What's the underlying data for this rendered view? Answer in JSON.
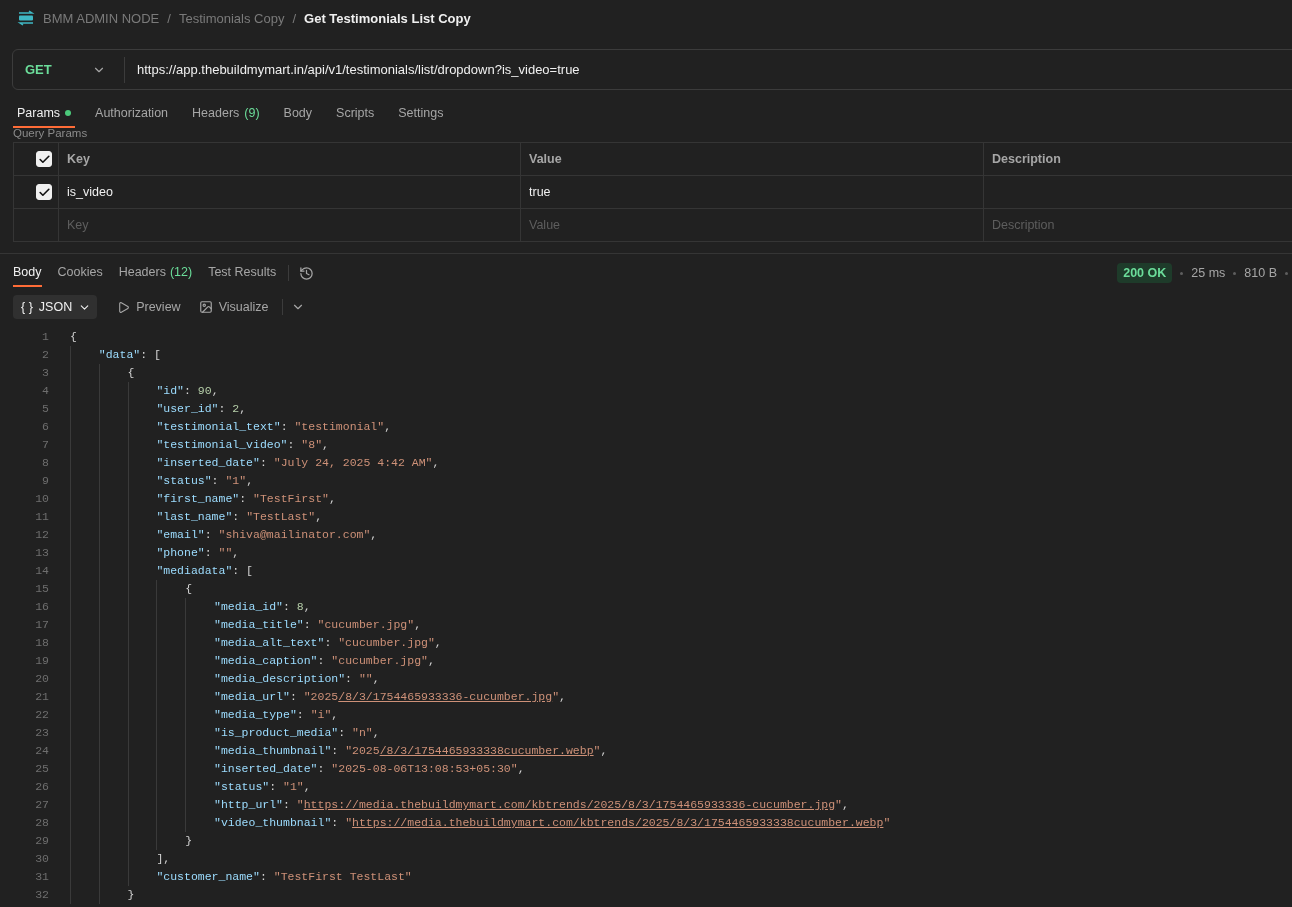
{
  "breadcrumb": [
    {
      "kind": "link",
      "label": "BMM ADMIN NODE"
    },
    {
      "kind": "separator",
      "label": "/"
    },
    {
      "kind": "link",
      "label": "Testimonials Copy"
    },
    {
      "kind": "separator",
      "label": "/"
    },
    {
      "kind": "current",
      "label": "Get Testimonials List Copy"
    }
  ],
  "request": {
    "method": "GET",
    "url": "https://app.thebuildmymart.in/api/v1/testimonials/list/dropdown?is_video=true"
  },
  "request_tabs": [
    {
      "label": "Params",
      "selected": true,
      "has_content": true
    },
    {
      "label": "Authorization",
      "selected": false,
      "has_content": false
    },
    {
      "label": "Headers",
      "count": "(9)",
      "selected": false,
      "has_content": false
    },
    {
      "label": "Body",
      "selected": false,
      "has_content": false
    },
    {
      "label": "Scripts",
      "selected": false,
      "has_content": false
    },
    {
      "label": "Settings",
      "selected": false,
      "has_content": false
    }
  ],
  "query_params": {
    "title": "Query Params",
    "all_checked": true,
    "columns": [
      "Key",
      "Value",
      "Description"
    ],
    "rows": [
      {
        "checked": true,
        "key": "is_video",
        "value": "true"
      }
    ],
    "new_row": {
      "key": "Key",
      "value": "Value",
      "description": "Description"
    }
  },
  "response_tabs": [
    {
      "label": "Body",
      "selected": true
    },
    {
      "label": "Cookies",
      "selected": false
    },
    {
      "label": "Headers",
      "count": "(12)",
      "selected": false
    },
    {
      "label": "Test Results",
      "selected": false
    }
  ],
  "status": {
    "code": "200 OK",
    "time": "25 ms",
    "size": "810 B"
  },
  "view": {
    "format_icon": "{ }",
    "format": "JSON",
    "options": [
      {
        "kind": "preview",
        "label": "Preview"
      },
      {
        "kind": "visualize",
        "label": "Visualize"
      }
    ]
  },
  "code": [
    {
      "n": "1",
      "t": [
        {
          "kind": "punct",
          "text": "{"
        }
      ],
      "children": [
        {
          "n": "2",
          "t": [
            {
              "kind": "key",
              "text": "\"data\""
            },
            {
              "kind": "punct",
              "text": ": ["
            }
          ],
          "children": [
            {
              "n": "3",
              "t": [
                {
                  "kind": "punct",
                  "text": "{"
                }
              ],
              "children": [
                {
                  "n": "4",
                  "t": [
                    {
                      "kind": "key",
                      "text": "\"id\""
                    },
                    {
                      "kind": "punct",
                      "text": ": "
                    },
                    {
                      "kind": "number",
                      "text": "90"
                    },
                    {
                      "kind": "punct",
                      "text": ","
                    }
                  ]
                },
                {
                  "n": "5",
                  "t": [
                    {
                      "kind": "key",
                      "text": "\"user_id\""
                    },
                    {
                      "kind": "punct",
                      "text": ": "
                    },
                    {
                      "kind": "number",
                      "text": "2"
                    },
                    {
                      "kind": "punct",
                      "text": ","
                    }
                  ]
                },
                {
                  "n": "6",
                  "t": [
                    {
                      "kind": "key",
                      "text": "\"testimonial_text\""
                    },
                    {
                      "kind": "punct",
                      "text": ": "
                    },
                    {
                      "kind": "string",
                      "text": "\"testimonial\""
                    },
                    {
                      "kind": "punct",
                      "text": ","
                    }
                  ]
                },
                {
                  "n": "7",
                  "t": [
                    {
                      "kind": "key",
                      "text": "\"testimonial_video\""
                    },
                    {
                      "kind": "punct",
                      "text": ": "
                    },
                    {
                      "kind": "string",
                      "text": "\"8\""
                    },
                    {
                      "kind": "punct",
                      "text": ","
                    }
                  ]
                },
                {
                  "n": "8",
                  "t": [
                    {
                      "kind": "key",
                      "text": "\"inserted_date\""
                    },
                    {
                      "kind": "punct",
                      "text": ": "
                    },
                    {
                      "kind": "string",
                      "text": "\"July 24, 2025 4:42 AM\""
                    },
                    {
                      "kind": "punct",
                      "text": ","
                    }
                  ]
                },
                {
                  "n": "9",
                  "t": [
                    {
                      "kind": "key",
                      "text": "\"status\""
                    },
                    {
                      "kind": "punct",
                      "text": ": "
                    },
                    {
                      "kind": "string",
                      "text": "\"1\""
                    },
                    {
                      "kind": "punct",
                      "text": ","
                    }
                  ]
                },
                {
                  "n": "10",
                  "t": [
                    {
                      "kind": "key",
                      "text": "\"first_name\""
                    },
                    {
                      "kind": "punct",
                      "text": ": "
                    },
                    {
                      "kind": "string",
                      "text": "\"TestFirst\""
                    },
                    {
                      "kind": "punct",
                      "text": ","
                    }
                  ]
                },
                {
                  "n": "11",
                  "t": [
                    {
                      "kind": "key",
                      "text": "\"last_name\""
                    },
                    {
                      "kind": "punct",
                      "text": ": "
                    },
                    {
                      "kind": "string",
                      "text": "\"TestLast\""
                    },
                    {
                      "kind": "punct",
                      "text": ","
                    }
                  ]
                },
                {
                  "n": "12",
                  "t": [
                    {
                      "kind": "key",
                      "text": "\"email\""
                    },
                    {
                      "kind": "punct",
                      "text": ": "
                    },
                    {
                      "kind": "string",
                      "text": "\"shiva@mailinator.com\""
                    },
                    {
                      "kind": "punct",
                      "text": ","
                    }
                  ]
                },
                {
                  "n": "13",
                  "t": [
                    {
                      "kind": "key",
                      "text": "\"phone\""
                    },
                    {
                      "kind": "punct",
                      "text": ": "
                    },
                    {
                      "kind": "string",
                      "text": "\"\""
                    },
                    {
                      "kind": "punct",
                      "text": ","
                    }
                  ]
                },
                {
                  "n": "14",
                  "t": [
                    {
                      "kind": "key",
                      "text": "\"mediadata\""
                    },
                    {
                      "kind": "punct",
                      "text": ": ["
                    }
                  ],
                  "children": [
                    {
                      "n": "15",
                      "t": [
                        {
                          "kind": "punct",
                          "text": "{"
                        }
                      ],
                      "children": [
                        {
                          "n": "16",
                          "t": [
                            {
                              "kind": "key",
                              "text": "\"media_id\""
                            },
                            {
                              "kind": "punct",
                              "text": ": "
                            },
                            {
                              "kind": "number",
                              "text": "8"
                            },
                            {
                              "kind": "punct",
                              "text": ","
                            }
                          ]
                        },
                        {
                          "n": "17",
                          "t": [
                            {
                              "kind": "key",
                              "text": "\"media_title\""
                            },
                            {
                              "kind": "punct",
                              "text": ": "
                            },
                            {
                              "kind": "string",
                              "text": "\"cucumber.jpg\""
                            },
                            {
                              "kind": "punct",
                              "text": ","
                            }
                          ]
                        },
                        {
                          "n": "18",
                          "t": [
                            {
                              "kind": "key",
                              "text": "\"media_alt_text\""
                            },
                            {
                              "kind": "punct",
                              "text": ": "
                            },
                            {
                              "kind": "string",
                              "text": "\"cucumber.jpg\""
                            },
                            {
                              "kind": "punct",
                              "text": ","
                            }
                          ]
                        },
                        {
                          "n": "19",
                          "t": [
                            {
                              "kind": "key",
                              "text": "\"media_caption\""
                            },
                            {
                              "kind": "punct",
                              "text": ": "
                            },
                            {
                              "kind": "string",
                              "text": "\"cucumber.jpg\""
                            },
                            {
                              "kind": "punct",
                              "text": ","
                            }
                          ]
                        },
                        {
                          "n": "20",
                          "t": [
                            {
                              "kind": "key",
                              "text": "\"media_description\""
                            },
                            {
                              "kind": "punct",
                              "text": ": "
                            },
                            {
                              "kind": "string",
                              "text": "\"\""
                            },
                            {
                              "kind": "punct",
                              "text": ","
                            }
                          ]
                        },
                        {
                          "n": "21",
                          "t": [
                            {
                              "kind": "key",
                              "text": "\"media_url\""
                            },
                            {
                              "kind": "punct",
                              "text": ": "
                            },
                            {
                              "kind": "string",
                              "text": "\"2025"
                            },
                            {
                              "kind": "link",
                              "text": "/8/3/1754465933336-cucumber.jpg"
                            },
                            {
                              "kind": "string",
                              "text": "\""
                            },
                            {
                              "kind": "punct",
                              "text": ","
                            }
                          ]
                        },
                        {
                          "n": "22",
                          "t": [
                            {
                              "kind": "key",
                              "text": "\"media_type\""
                            },
                            {
                              "kind": "punct",
                              "text": ": "
                            },
                            {
                              "kind": "string",
                              "text": "\"i\""
                            },
                            {
                              "kind": "punct",
                              "text": ","
                            }
                          ]
                        },
                        {
                          "n": "23",
                          "t": [
                            {
                              "kind": "key",
                              "text": "\"is_product_media\""
                            },
                            {
                              "kind": "punct",
                              "text": ": "
                            },
                            {
                              "kind": "string",
                              "text": "\"n\""
                            },
                            {
                              "kind": "punct",
                              "text": ","
                            }
                          ]
                        },
                        {
                          "n": "24",
                          "t": [
                            {
                              "kind": "key",
                              "text": "\"media_thumbnail\""
                            },
                            {
                              "kind": "punct",
                              "text": ": "
                            },
                            {
                              "kind": "string",
                              "text": "\"2025"
                            },
                            {
                              "kind": "link",
                              "text": "/8/3/1754465933338cucumber.webp"
                            },
                            {
                              "kind": "string",
                              "text": "\""
                            },
                            {
                              "kind": "punct",
                              "text": ","
                            }
                          ]
                        },
                        {
                          "n": "25",
                          "t": [
                            {
                              "kind": "key",
                              "text": "\"inserted_date\""
                            },
                            {
                              "kind": "punct",
                              "text": ": "
                            },
                            {
                              "kind": "string",
                              "text": "\"2025-08-06T13:08:53+05:30\""
                            },
                            {
                              "kind": "punct",
                              "text": ","
                            }
                          ]
                        },
                        {
                          "n": "26",
                          "t": [
                            {
                              "kind": "key",
                              "text": "\"status\""
                            },
                            {
                              "kind": "punct",
                              "text": ": "
                            },
                            {
                              "kind": "string",
                              "text": "\"1\""
                            },
                            {
                              "kind": "punct",
                              "text": ","
                            }
                          ]
                        },
                        {
                          "n": "27",
                          "t": [
                            {
                              "kind": "key",
                              "text": "\"http_url\""
                            },
                            {
                              "kind": "punct",
                              "text": ": "
                            },
                            {
                              "kind": "string",
                              "text": "\""
                            },
                            {
                              "kind": "link",
                              "text": "https://media.thebuildmymart.com/kbtrends/2025/8/3/1754465933336-cucumber.jpg"
                            },
                            {
                              "kind": "string",
                              "text": "\""
                            },
                            {
                              "kind": "punct",
                              "text": ","
                            }
                          ]
                        },
                        {
                          "n": "28",
                          "t": [
                            {
                              "kind": "key",
                              "text": "\"video_thumbnail\""
                            },
                            {
                              "kind": "punct",
                              "text": ": "
                            },
                            {
                              "kind": "string",
                              "text": "\""
                            },
                            {
                              "kind": "link",
                              "text": "https://media.thebuildmymart.com/kbtrends/2025/8/3/1754465933338cucumber.webp"
                            },
                            {
                              "kind": "string",
                              "text": "\""
                            }
                          ]
                        }
                      ]
                    },
                    {
                      "n": "29",
                      "t": [
                        {
                          "kind": "punct",
                          "text": "}"
                        }
                      ]
                    }
                  ]
                },
                {
                  "n": "30",
                  "t": [
                    {
                      "kind": "punct",
                      "text": "],"
                    }
                  ]
                },
                {
                  "n": "31",
                  "t": [
                    {
                      "kind": "key",
                      "text": "\"customer_name\""
                    },
                    {
                      "kind": "punct",
                      "text": ": "
                    },
                    {
                      "kind": "string",
                      "text": "\"TestFirst TestLast\""
                    }
                  ]
                }
              ]
            },
            {
              "n": "32",
              "t": [
                {
                  "kind": "punct",
                  "text": "}"
                }
              ]
            }
          ]
        }
      ]
    }
  ]
}
